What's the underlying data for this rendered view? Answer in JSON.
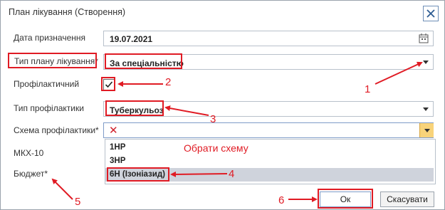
{
  "window": {
    "title": "План лікування (Створення)"
  },
  "fields": {
    "date_label": "Дата призначення",
    "date_value": "19.07.2021",
    "plan_type_label": "Тип плану лікування*",
    "plan_type_value": "За спеціальністю",
    "preventive_label": "Профілактичний",
    "preventive_checked": true,
    "prevention_type_label": "Тип профілактики",
    "prevention_type_value": "Туберкульоз",
    "scheme_label": "Схема профілактики*",
    "mkx_label": "МКХ-10",
    "budget_label": "Бюджет*"
  },
  "dropdown": {
    "options": [
      "1НР",
      "3НР",
      "6Н (Ізоніазид)"
    ],
    "selected_index": 2
  },
  "annotations": {
    "hint": "Обрати схему",
    "n1": "1",
    "n2": "2",
    "n3": "3",
    "n4": "4",
    "n5": "5",
    "n6": "6"
  },
  "buttons": {
    "ok": "Ок",
    "cancel": "Скасувати"
  },
  "colors": {
    "annotation": "#e01b24",
    "dropdown_button": "#f8d37a",
    "selected_row": "#cfd3dc"
  }
}
